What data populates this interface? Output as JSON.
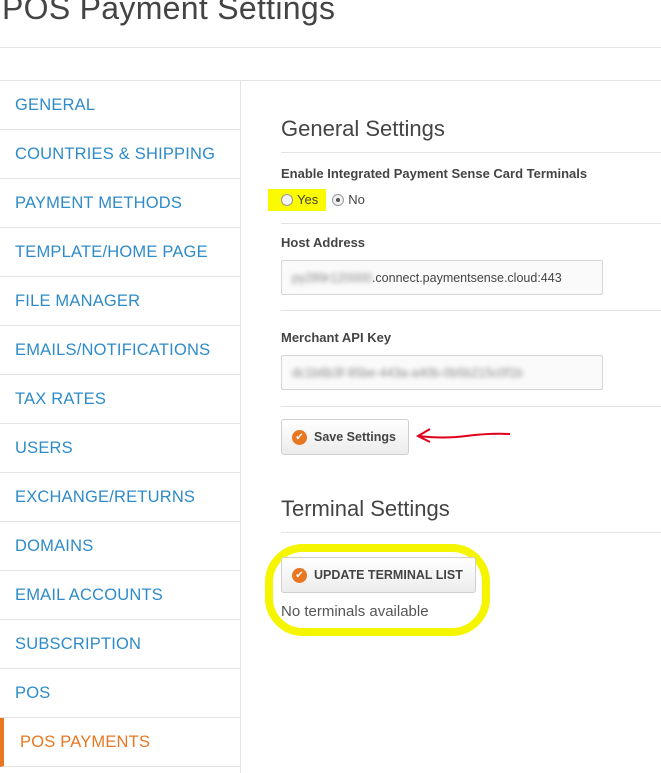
{
  "page": {
    "title": "POS Payment Settings"
  },
  "sidebar": {
    "items": [
      {
        "label": "GENERAL"
      },
      {
        "label": "COUNTRIES & SHIPPING"
      },
      {
        "label": "PAYMENT METHODS"
      },
      {
        "label": "TEMPLATE/HOME PAGE"
      },
      {
        "label": "FILE MANAGER"
      },
      {
        "label": "EMAILS/NOTIFICATIONS"
      },
      {
        "label": "TAX RATES"
      },
      {
        "label": "USERS"
      },
      {
        "label": "EXCHANGE/RETURNS"
      },
      {
        "label": "DOMAINS"
      },
      {
        "label": "EMAIL ACCOUNTS"
      },
      {
        "label": "SUBSCRIPTION"
      },
      {
        "label": "POS"
      },
      {
        "label": "POS PAYMENTS",
        "active": true
      }
    ]
  },
  "general": {
    "title": "General Settings",
    "enable_label": "Enable Integrated Payment Sense Card Terminals",
    "option_yes": "Yes",
    "option_no": "No",
    "selected": "No",
    "host_label": "Host Address",
    "host_blurred": "py289r120000",
    "host_value": ".connect.paymentsense.cloud:443",
    "api_label": "Merchant API Key",
    "api_value": "dc1b6b3f-95be-443a-a40b-0b5b215c0f1b",
    "save_label": "Save Settings"
  },
  "terminal": {
    "title": "Terminal Settings",
    "update_label": "UPDATE TERMINAL LIST",
    "empty_text": "No terminals available"
  },
  "colors": {
    "accent": "#e87722",
    "link": "#2e8bc9",
    "highlight": "#fafa00",
    "annotation_arrow": "#e0001b"
  }
}
